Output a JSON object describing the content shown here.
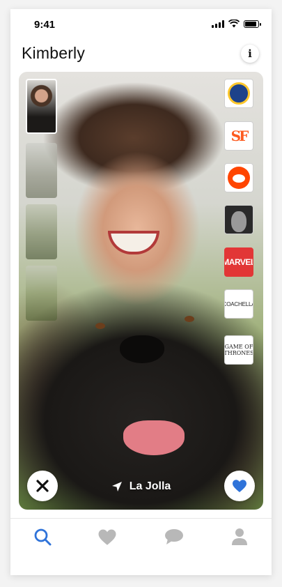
{
  "status_bar": {
    "time": "9:41"
  },
  "header": {
    "title": "Kimberly",
    "info_icon": "i"
  },
  "card": {
    "location": "La Jolla",
    "photos": [
      "photo-1",
      "photo-2",
      "photo-3",
      "photo-4"
    ],
    "active_photo": 0,
    "interests": [
      "warriors-logo",
      "giants-logo",
      "reddit-logo",
      "eminem-photo",
      "marvel-logo",
      "coachella-logo",
      "game-of-thrones-logo"
    ],
    "marvel_text": "MARVEL",
    "coachella_text": "COACHELLA",
    "got_line1": "GAME OF",
    "got_line2": "THRONES",
    "giants_text": "SF"
  },
  "tabs": [
    "search-icon",
    "heart-icon",
    "chat-icon",
    "person-icon"
  ],
  "colors": {
    "accent": "#2f73d9",
    "inactive_icon": "#b8b8b8",
    "marvel": "#e23636",
    "reddit": "#ff4500"
  }
}
